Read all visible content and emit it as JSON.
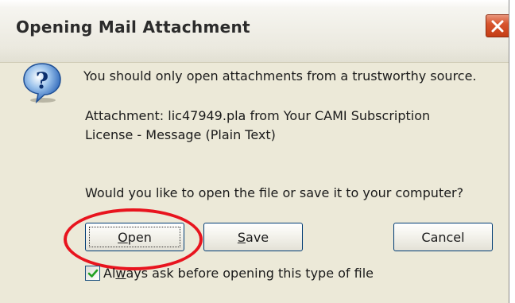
{
  "window": {
    "title": "Opening Mail Attachment",
    "close_icon": "close-icon"
  },
  "dialog": {
    "icon": "question-icon",
    "message": "You should only open attachments from a trustworthy source.",
    "attachment_line1": "Attachment: lic47949.pla from Your CAMI Subscription",
    "attachment_line2": "License - Message (Plain Text)",
    "question": "Would you like to open the file or save it to your computer?"
  },
  "buttons": {
    "open": {
      "prefix": "",
      "mnemonic": "O",
      "suffix": "pen"
    },
    "save": {
      "prefix": "",
      "mnemonic": "S",
      "suffix": "ave"
    },
    "cancel": "Cancel"
  },
  "checkbox": {
    "checked": true,
    "label_prefix": "Al",
    "label_mnemonic": "w",
    "label_suffix": "ays ask before opening this type of file"
  },
  "colors": {
    "dialog_bg": "#ece9d8",
    "highlight_ring": "#e8141e",
    "close_button": "#d8552e"
  }
}
